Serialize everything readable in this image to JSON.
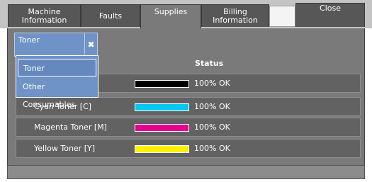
{
  "tabs": {
    "machine_information": "Machine\nInformation",
    "faults": "Faults",
    "supplies": "Supplies",
    "billing_information": "Billing\nInformation",
    "close": "Close"
  },
  "filter": {
    "selected": "Toner",
    "clear_icon": "x-icon",
    "options": [
      "Toner",
      "Other Consumables"
    ]
  },
  "table": {
    "status_header": "Status",
    "rows": [
      {
        "name": "",
        "color": "#000000",
        "level_percent": 100,
        "status": "100% OK"
      },
      {
        "name": "Cyan Toner [C]",
        "color": "#00c8f0",
        "level_percent": 100,
        "status": "100% OK"
      },
      {
        "name": "Magenta Toner [M]",
        "color": "#e6008c",
        "level_percent": 100,
        "status": "100% OK"
      },
      {
        "name": "Yellow Toner [Y]",
        "color": "#fff200",
        "level_percent": 100,
        "status": "100% OK"
      }
    ]
  },
  "colors": {
    "active_accent": "#6f93c6",
    "tab_bg": "#575757",
    "panel_bg": "#7a7a7a"
  }
}
